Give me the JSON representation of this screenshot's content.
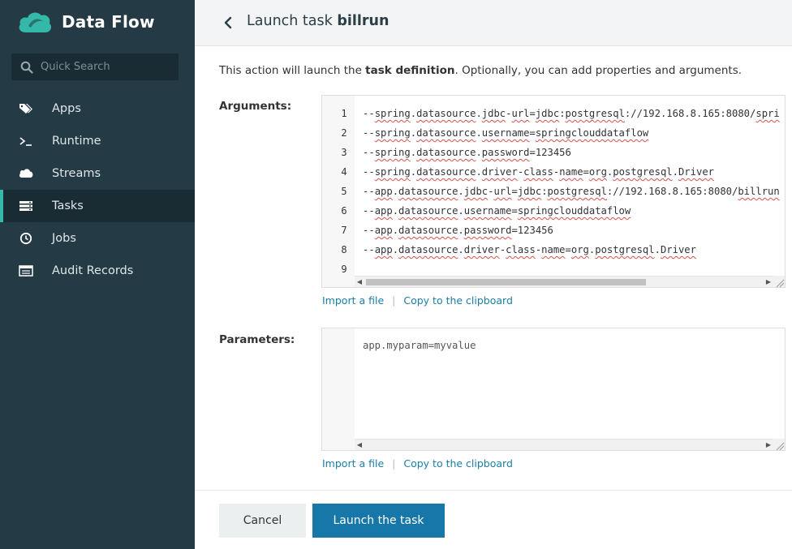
{
  "app": {
    "title": "Data Flow",
    "colors": {
      "sidebar_bg": "#243b45",
      "accent": "#34b8a9",
      "primary_button": "#1677a8",
      "link": "#1b7ea6"
    }
  },
  "search": {
    "placeholder": "Quick Search"
  },
  "sidebar": {
    "items": [
      {
        "label": "Apps",
        "icon": "tags-icon",
        "active": false
      },
      {
        "label": "Runtime",
        "icon": "terminal-icon",
        "active": false
      },
      {
        "label": "Streams",
        "icon": "cloud-icon",
        "active": false
      },
      {
        "label": "Tasks",
        "icon": "tasks-icon",
        "active": true
      },
      {
        "label": "Jobs",
        "icon": "clock-icon",
        "active": false
      },
      {
        "label": "Audit Records",
        "icon": "list-icon",
        "active": false
      }
    ]
  },
  "header": {
    "title_prefix": "Launch task ",
    "task_name": "billrun"
  },
  "main": {
    "desc_prefix": "This action will launch the ",
    "desc_bold": "task definition",
    "desc_suffix": ". Optionally, you can add properties and arguments.",
    "arguments_label": "Arguments:",
    "parameters_label": "Parameters:",
    "import_link": "Import a file",
    "copy_link": "Copy to the clipboard",
    "parameters_placeholder": "app.myparam=myvalue"
  },
  "arguments": [
    {
      "num": "1",
      "text": "--spring.datasource.jdbc-url=jdbc:postgresql://192.168.8.165:8080/spri"
    },
    {
      "num": "2",
      "text": "--spring.datasource.username=springclouddataflow"
    },
    {
      "num": "3",
      "text": "--spring.datasource.password=123456"
    },
    {
      "num": "4",
      "text": "--spring.datasource.driver-class-name=org.postgresql.Driver"
    },
    {
      "num": "5",
      "text": "--app.datasource.jdbc-url=jdbc:postgresql://192.168.8.165:8080/billrun"
    },
    {
      "num": "6",
      "text": "--app.datasource.username=springclouddataflow"
    },
    {
      "num": "7",
      "text": "--app.datasource.password=123456"
    },
    {
      "num": "8",
      "text": "--app.datasource.driver-class-name=org.postgresql.Driver"
    },
    {
      "num": "9",
      "text": ""
    }
  ],
  "footer": {
    "cancel_label": "Cancel",
    "launch_label": "Launch the task"
  }
}
